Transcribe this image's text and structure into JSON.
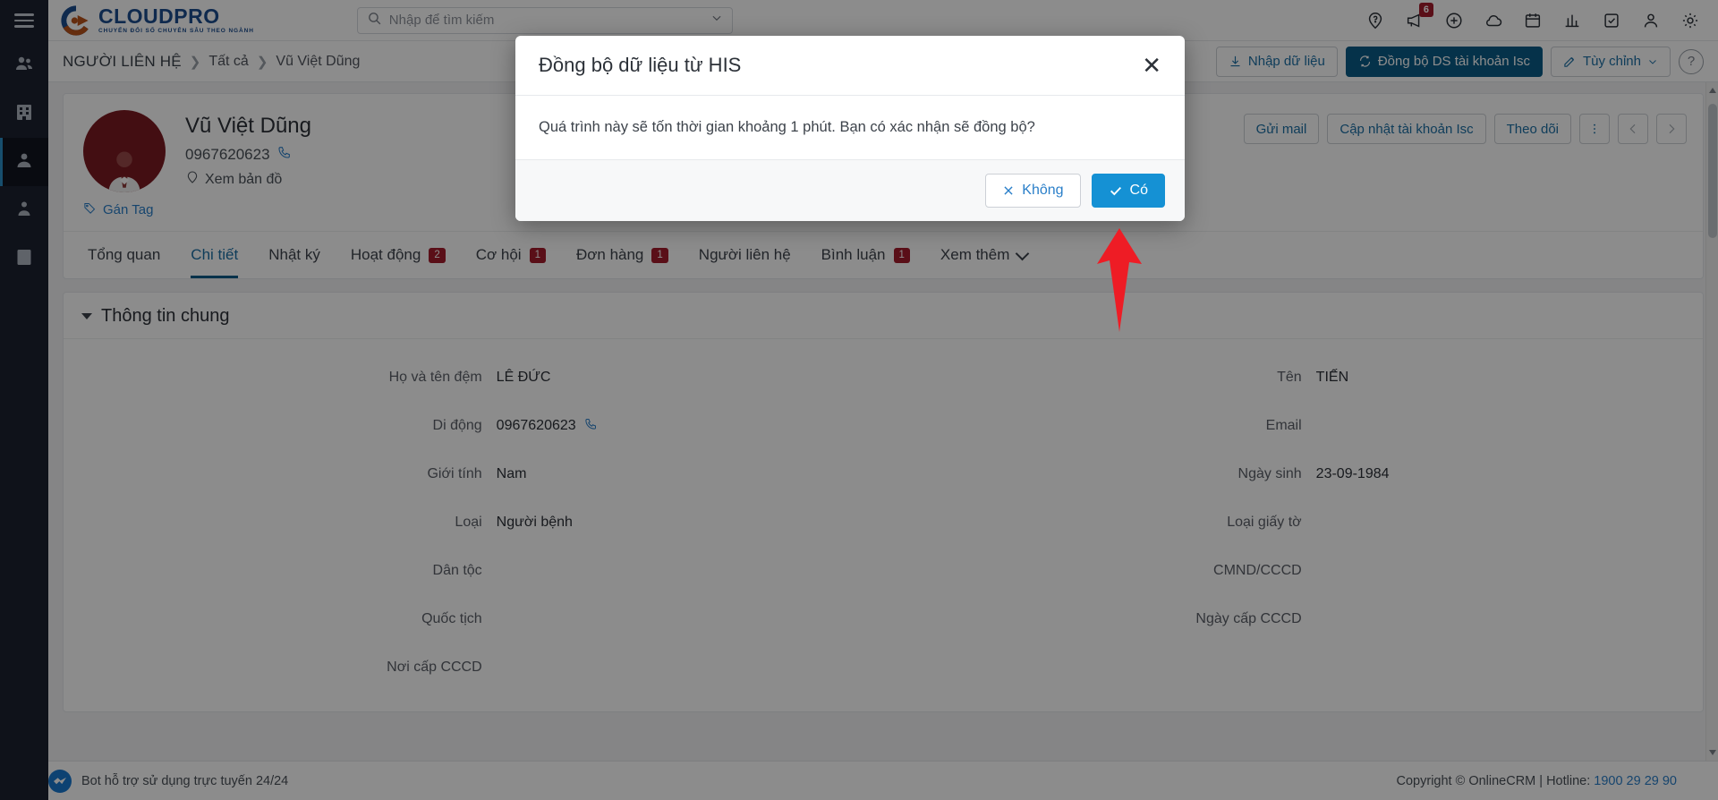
{
  "rail": {
    "menu_icon": "hamburger-menu-icon",
    "items": [
      {
        "name": "contacts-group",
        "icon": "people-icon"
      },
      {
        "name": "organizations",
        "icon": "building-icon"
      },
      {
        "name": "contact-person",
        "icon": "person-card-icon",
        "active": true
      },
      {
        "name": "user",
        "icon": "user-icon"
      },
      {
        "name": "document-user",
        "icon": "id-card-icon"
      }
    ]
  },
  "brand": {
    "name": "CLOUDPRO",
    "tagline": "CHUYỂN ĐỔI SỐ CHUYÊN SÂU THEO NGÀNH"
  },
  "search": {
    "placeholder": "Nhập để tìm kiếm",
    "value": ""
  },
  "topicons": [
    {
      "name": "help-location-icon",
      "badge": ""
    },
    {
      "name": "megaphone-icon",
      "badge": "6"
    },
    {
      "name": "plus-circle-icon",
      "badge": ""
    },
    {
      "name": "cloud-icon",
      "badge": ""
    },
    {
      "name": "calendar-icon",
      "badge": ""
    },
    {
      "name": "chart-icon",
      "badge": ""
    },
    {
      "name": "task-check-icon",
      "badge": ""
    },
    {
      "name": "account-icon",
      "badge": ""
    },
    {
      "name": "settings-gear-icon",
      "badge": ""
    }
  ],
  "breadcrumb": {
    "title": "NGƯỜI LIÊN HỆ",
    "sep": "❯",
    "level2": "Tất cả",
    "level3": "Vũ Việt Dũng"
  },
  "crumb_actions": {
    "import_label": "Nhập dữ liệu",
    "sync_label": "Đồng bộ DS tài khoản Isc",
    "custom_label": "Tùy chỉnh",
    "help_label": "?"
  },
  "profile": {
    "name": "Vũ Việt Dũng",
    "phone": "0967620623",
    "map_label": "Xem bản đồ",
    "tag_label": "Gán Tag",
    "actions": {
      "mail_label": "Gửi mail",
      "update_label": "Cập nhật tài khoản Isc",
      "follow_label": "Theo dõi",
      "more_icon": "kebab-menu-icon",
      "prev_icon": "chevron-left-icon",
      "next_icon": "chevron-right-icon"
    }
  },
  "tabs": [
    {
      "label": "Tổng quan",
      "badge": "",
      "active": false
    },
    {
      "label": "Chi tiết",
      "badge": "",
      "active": true
    },
    {
      "label": "Nhật ký",
      "badge": "",
      "active": false
    },
    {
      "label": "Hoạt động",
      "badge": "2",
      "active": false
    },
    {
      "label": "Cơ hội",
      "badge": "1",
      "active": false
    },
    {
      "label": "Đơn hàng",
      "badge": "1",
      "active": false
    },
    {
      "label": "Người liên hệ",
      "badge": "",
      "active": false
    },
    {
      "label": "Bình luận",
      "badge": "1",
      "active": false
    },
    {
      "label": "Xem thêm",
      "badge": "",
      "active": false,
      "chevron": true
    }
  ],
  "section": {
    "title": "Thông tin chung",
    "left_fields": [
      {
        "label": "Họ và tên đệm",
        "value": "LÊ ĐỨC",
        "icon": ""
      },
      {
        "label": "Di động",
        "value": "0967620623",
        "icon": "phone-icon"
      },
      {
        "label": "Giới tính",
        "value": "Nam",
        "icon": ""
      },
      {
        "label": "Loại",
        "value": "Người bệnh",
        "icon": ""
      },
      {
        "label": "Dân tộc",
        "value": "",
        "icon": ""
      },
      {
        "label": "Quốc tịch",
        "value": "",
        "icon": ""
      },
      {
        "label": "Nơi cấp CCCD",
        "value": "",
        "icon": ""
      }
    ],
    "right_fields": [
      {
        "label": "Tên",
        "value": "TIẾN",
        "icon": ""
      },
      {
        "label": "Email",
        "value": "",
        "icon": ""
      },
      {
        "label": "Ngày sinh",
        "value": "23-09-1984",
        "icon": ""
      },
      {
        "label": "Loại giấy tờ",
        "value": "",
        "icon": ""
      },
      {
        "label": "CMND/CCCD",
        "value": "",
        "icon": ""
      },
      {
        "label": "Ngày cấp CCCD",
        "value": "",
        "icon": ""
      }
    ]
  },
  "modal": {
    "title": "Đồng bộ dữ liệu từ HIS",
    "close_icon": "close-icon",
    "body": "Quá trình này sẽ tốn thời gian khoảng 1 phút. Bạn có xác nhận sẽ đồng bộ?",
    "no_label": "Không",
    "yes_label": "Có"
  },
  "footer": {
    "bot_text": "Bot hỗ trợ sử dụng trực tuyến 24/24",
    "copyright": "Copyright © OnlineCRM | Hotline: ",
    "hotline": "1900 29 29 90"
  },
  "colors": {
    "accent": "#0a5c87",
    "link": "#2a7fc9",
    "badge": "#a51d2d",
    "modal_yes": "#1591d4",
    "rail": "#1c2230",
    "avatar": "#7a1b22",
    "arrow": "#ee1c25"
  }
}
